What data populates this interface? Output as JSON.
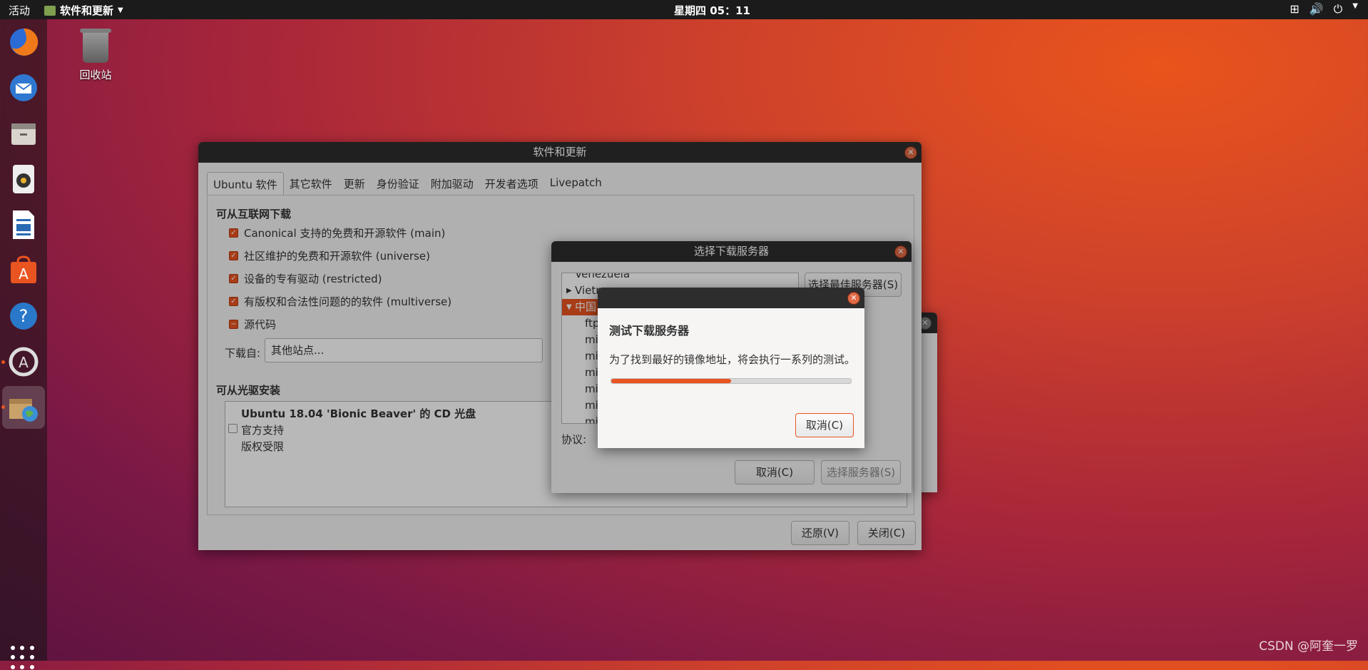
{
  "topbar": {
    "activities": "活动",
    "app_name": "软件和更新",
    "clock": "星期四 05：11",
    "tray_icons": [
      "network-icon",
      "volume-icon",
      "power-icon"
    ]
  },
  "desktop": {
    "trash_label": "回收站"
  },
  "dock": {
    "items": [
      "firefox-icon",
      "thunderbird-icon",
      "files-icon",
      "rhythmbox-icon",
      "writer-icon",
      "software-center-icon",
      "help-icon",
      "software-updater-icon",
      "software-properties-icon"
    ]
  },
  "main_window": {
    "title": "软件和更新",
    "tabs": [
      "Ubuntu 软件",
      "其它软件",
      "更新",
      "身份验证",
      "附加驱动",
      "开发者选项",
      "Livepatch"
    ],
    "internet_heading": "可从互联网下载",
    "checkboxes": [
      {
        "label": "Canonical 支持的免费和开源软件 (main)",
        "checked": true
      },
      {
        "label": "社区维护的免费和开源软件 (universe)",
        "checked": true
      },
      {
        "label": "设备的专有驱动 (restricted)",
        "checked": true
      },
      {
        "label": "有版权和合法性问题的的软件 (multiverse)",
        "checked": true
      },
      {
        "label": "源代码",
        "checked": "partial"
      }
    ],
    "download_from_label": "下载自:",
    "download_from_value": "其他站点...",
    "cdrom_heading": "可从光驱安装",
    "cdrom_title": "Ubuntu 18.04 'Bionic Beaver' 的 CD 光盘",
    "cdrom_line1": "官方支持",
    "cdrom_line2": "版权受限",
    "revert_button": "还原(V)",
    "close_button": "关闭(C)"
  },
  "server_dialog": {
    "title": "选择下载服务器",
    "list": [
      {
        "label": "Venezuela",
        "type": "country-collapsed"
      },
      {
        "label": "Vietnam",
        "type": "country-collapsed"
      },
      {
        "label": "中国",
        "type": "country-expanded"
      },
      {
        "label": "ftp",
        "type": "mirror"
      },
      {
        "label": "mi",
        "type": "mirror"
      },
      {
        "label": "mi",
        "type": "mirror"
      },
      {
        "label": "mi",
        "type": "mirror"
      },
      {
        "label": "mi",
        "type": "mirror"
      },
      {
        "label": "mi",
        "type": "mirror"
      },
      {
        "label": "mi",
        "type": "mirror"
      }
    ],
    "best_server_button": "选择最佳服务器(S)",
    "protocol_label": "协议:",
    "cancel_button": "取消(C)",
    "choose_button": "选择服务器(S)"
  },
  "test_dialog": {
    "heading": "测试下载服务器",
    "message": "为了找到最好的镜像地址，将会执行一系列的测试。",
    "progress": 0.5,
    "cancel_button": "取消(C)"
  },
  "watermark": "CSDN @阿奎一罗",
  "colors": {
    "accent": "#e95420",
    "titlebar": "#2d2d2d"
  }
}
